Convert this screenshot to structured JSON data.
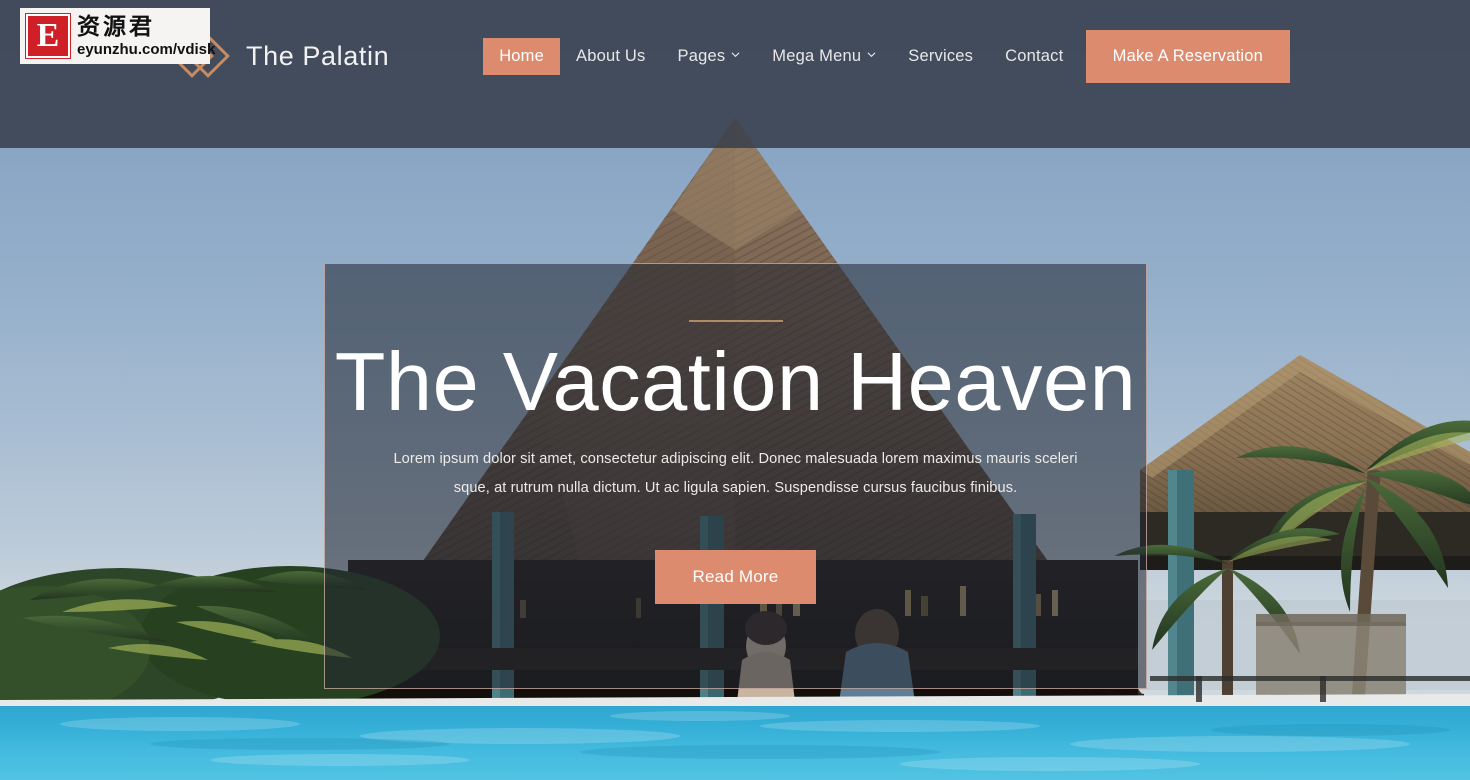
{
  "watermark": {
    "badge_letter": "E",
    "chinese": "资源君",
    "url": "eyunzhu.com/vdisk"
  },
  "header": {
    "brand": {
      "name": "The Palatin",
      "logo_icon": "double-diamond-icon"
    },
    "nav": [
      {
        "label": "Home",
        "active": true,
        "has_caret": false,
        "icon": ""
      },
      {
        "label": "About Us",
        "active": false,
        "has_caret": false,
        "icon": ""
      },
      {
        "label": "Pages",
        "active": false,
        "has_caret": true,
        "icon": "chevron-down-icon"
      },
      {
        "label": "Mega Menu",
        "active": false,
        "has_caret": true,
        "icon": "chevron-down-icon"
      },
      {
        "label": "Services",
        "active": false,
        "has_caret": false,
        "icon": ""
      },
      {
        "label": "Contact",
        "active": false,
        "has_caret": false,
        "icon": ""
      }
    ],
    "reserve_label": "Make A Reservation"
  },
  "hero": {
    "title": "The Vacation Heaven",
    "paragraph": "Lorem ipsum dolor sit amet, consectetur adipiscing elit. Donec malesuada lorem maximus mauris sceleri sque, at rutrum nulla dictum. Ut ac ligula sapien. Suspendisse cursus faucibus finibus.",
    "cta_label": "Read More",
    "background_alt": "Tropical resort swim-up bar with thatched palapa roof, palm trees and turquoise pool"
  },
  "colors": {
    "accent": "#dd8b6e",
    "header_bg": "#383e4a",
    "hero_overlay": "#222732",
    "hero_rule": "#b08a63",
    "pool_water": "#34a8d0",
    "sky_top": "#7e9cc0",
    "thatch": "#7b6450",
    "foliage": "#2f4a2c",
    "watermark_red": "#cf2027"
  }
}
